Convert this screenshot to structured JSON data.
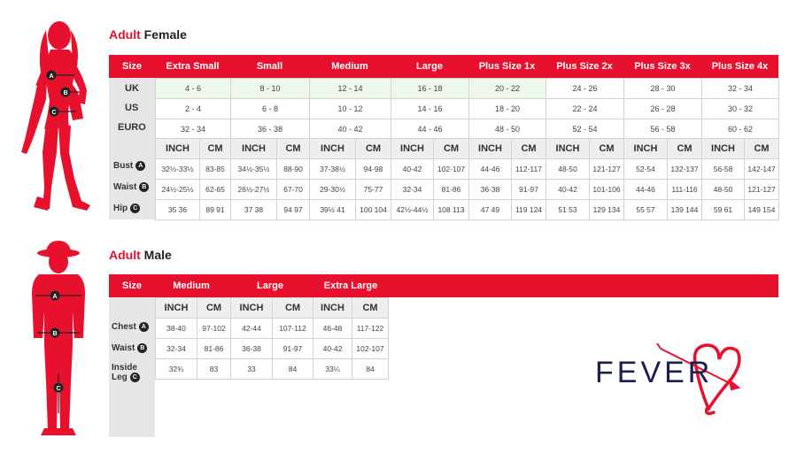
{
  "female": {
    "title_red": "Adult",
    "title_black": "Female",
    "header_label": "Size",
    "sizes": [
      "Extra Small",
      "Small",
      "Medium",
      "Large",
      "Plus Size 1x",
      "Plus Size 2x",
      "Plus Size 3x",
      "Plus Size 4x"
    ],
    "region_rows": [
      {
        "label": "UK",
        "values": [
          "4 - 6",
          "8 - 10",
          "12 - 14",
          "16 - 18",
          "20 - 22",
          "24 - 26",
          "28 - 30",
          "32 - 34"
        ]
      },
      {
        "label": "US",
        "values": [
          "2 - 4",
          "6 - 8",
          "10 - 12",
          "14 - 16",
          "18 - 20",
          "22 - 24",
          "26 - 28",
          "30 - 32"
        ]
      },
      {
        "label": "EURO",
        "values": [
          "32 - 34",
          "36 - 38",
          "40 - 42",
          "44 - 46",
          "48 - 50",
          "52 - 54",
          "56 - 58",
          "60 - 62"
        ]
      }
    ],
    "unit_inch": "INCH",
    "unit_cm": "CM",
    "measure_rows": [
      {
        "label": "Bust",
        "badge": "A",
        "values": [
          "32½-33½",
          "83-85",
          "34½-35½",
          "88-90",
          "37-38½",
          "94-98",
          "40-42",
          "102-107",
          "44-46",
          "112-117",
          "48-50",
          "121-127",
          "52-54",
          "132-137",
          "56-58",
          "142-147"
        ]
      },
      {
        "label": "Waist",
        "badge": "B",
        "values": [
          "24½-25½",
          "62-65",
          "26½-27½",
          "67-70",
          "29-30½",
          "75-77",
          "32-34",
          "81-86",
          "36-38",
          "91-97",
          "40-42",
          "101-106",
          "44-46",
          "111-116",
          "48-50",
          "121-127"
        ]
      },
      {
        "label": "Hip",
        "badge": "C",
        "values": [
          "35 36",
          "89 91",
          "37 38",
          "94 97",
          "39½ 41",
          "100 104",
          "42½-44½",
          "108 113",
          "47 49",
          "119 124",
          "51 53",
          "129 134",
          "55 57",
          "139 144",
          "59 61",
          "149 154"
        ]
      }
    ],
    "figure_badges": [
      "A",
      "B",
      "C"
    ]
  },
  "male": {
    "title_red": "Adult",
    "title_black": "Male",
    "header_label": "Size",
    "sizes": [
      "Medium",
      "Large",
      "Extra Large"
    ],
    "unit_inch": "INCH",
    "unit_cm": "CM",
    "measure_rows": [
      {
        "label": "Chest",
        "badge": "A",
        "values": [
          "38-40",
          "97-102",
          "42-44",
          "107-112",
          "46-48",
          "117-122"
        ]
      },
      {
        "label": "Waist",
        "badge": "B",
        "values": [
          "32-34",
          "81-86",
          "36-38",
          "91-97",
          "40-42",
          "102-107"
        ]
      },
      {
        "label": "Inside Leg",
        "badge": "C",
        "values": [
          "32¾",
          "83",
          "33",
          "84",
          "33¼",
          "84"
        ]
      }
    ],
    "figure_badges": [
      "A",
      "B",
      "C"
    ]
  },
  "brand": {
    "logo_text": "FEVER",
    "accent_color": "#e8112d",
    "text_color": "#1a1f4d"
  }
}
